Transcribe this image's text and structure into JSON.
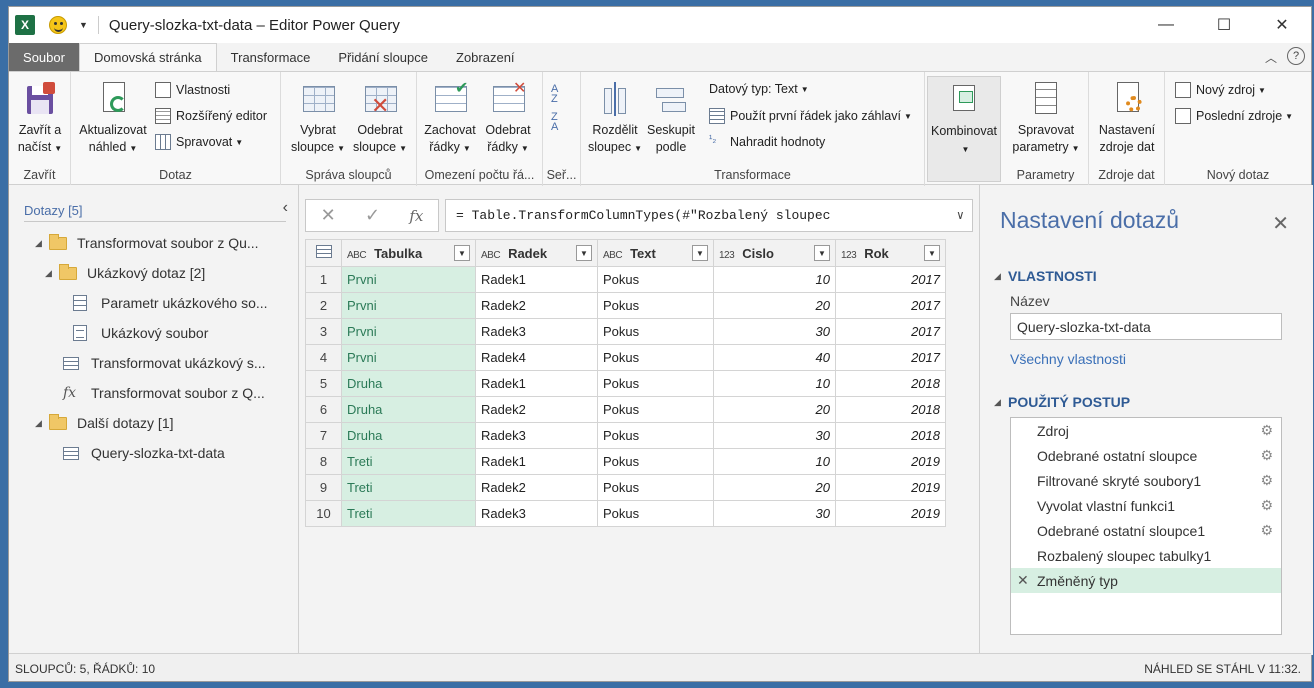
{
  "window": {
    "title": "Query-slozka-txt-data – Editor Power Query",
    "app_icon": "X",
    "minimize": "—",
    "maximize": "☐",
    "close": "✕"
  },
  "tabs": [
    "Soubor",
    "Domovská stránka",
    "Transformace",
    "Přidání sloupce",
    "Zobrazení"
  ],
  "ribbon": {
    "close_load": "Zavřít a načíst",
    "refresh_preview": "Aktualizovat náhled",
    "properties": "Vlastnosti",
    "advanced_editor": "Rozšířený editor",
    "manage": "Spravovat",
    "choose_columns": "Vybrat sloupce",
    "remove_columns": "Odebrat sloupce",
    "keep_rows": "Zachovat řádky",
    "remove_rows": "Odebrat řádky",
    "split_column": "Rozdělit sloupec",
    "group_by": "Seskupit podle",
    "data_type": "Datový typ: Text",
    "use_first_row": "Použít první řádek jako záhlaví",
    "replace_values": "Nahradit hodnoty",
    "combine": "Kombinovat",
    "manage_params": "Spravovat parametry",
    "data_source_settings": "Nastavení zdroje dat",
    "new_source": "Nový zdroj",
    "recent_sources": "Poslední zdroje",
    "groups": {
      "close": "Zavřít",
      "query": "Dotaz",
      "manage_columns": "Správa sloupců",
      "reduce_rows": "Omezení počtu řá...",
      "sort": "Seř...",
      "transform": "Transformace",
      "parameters": "Parametry",
      "data_sources": "Zdroje dat",
      "new_query": "Nový dotaz"
    }
  },
  "queries": {
    "header": "Dotazy [5]",
    "items": [
      "Transformovat soubor z Qu...",
      "Ukázkový dotaz [2]",
      "Parametr ukázkového so...",
      "Ukázkový soubor",
      "Transformovat ukázkový s...",
      "Transformovat soubor z Q...",
      "Další dotazy [1]",
      "Query-slozka-txt-data"
    ]
  },
  "formula": {
    "text": "= Table.TransformColumnTypes(#\"Rozbalený sloupec",
    "cancel": "✕",
    "commit": "✓",
    "fx": "fx"
  },
  "grid": {
    "columns": [
      {
        "type": "ABC",
        "name": "Tabulka"
      },
      {
        "type": "ABC",
        "name": "Radek"
      },
      {
        "type": "ABC",
        "name": "Text"
      },
      {
        "type": "123",
        "name": "Cislo"
      },
      {
        "type": "123",
        "name": "Rok"
      }
    ],
    "rows": [
      [
        "1",
        "Prvni",
        "Radek1",
        "Pokus",
        "10",
        "2017"
      ],
      [
        "2",
        "Prvni",
        "Radek2",
        "Pokus",
        "20",
        "2017"
      ],
      [
        "3",
        "Prvni",
        "Radek3",
        "Pokus",
        "30",
        "2017"
      ],
      [
        "4",
        "Prvni",
        "Radek4",
        "Pokus",
        "40",
        "2017"
      ],
      [
        "5",
        "Druha",
        "Radek1",
        "Pokus",
        "10",
        "2018"
      ],
      [
        "6",
        "Druha",
        "Radek2",
        "Pokus",
        "20",
        "2018"
      ],
      [
        "7",
        "Druha",
        "Radek3",
        "Pokus",
        "30",
        "2018"
      ],
      [
        "8",
        "Treti",
        "Radek1",
        "Pokus",
        "10",
        "2019"
      ],
      [
        "9",
        "Treti",
        "Radek2",
        "Pokus",
        "20",
        "2019"
      ],
      [
        "10",
        "Treti",
        "Radek3",
        "Pokus",
        "30",
        "2019"
      ]
    ]
  },
  "settings": {
    "title": "Nastavení dotazů",
    "properties_header": "VLASTNOSTI",
    "name_label": "Název",
    "name_value": "Query-slozka-txt-data",
    "all_properties": "Všechny vlastnosti",
    "steps_header": "POUŽITÝ POSTUP",
    "steps": [
      "Zdroj",
      "Odebrané ostatní sloupce",
      "Filtrované skryté soubory1",
      "Vyvolat vlastní funkci1",
      "Odebrané ostatní sloupce1",
      "Rozbalený sloupec tabulky1",
      "Změněný typ"
    ]
  },
  "status": {
    "left": "SLOUPCŮ: 5, ŘÁDKŮ: 10",
    "right": "NÁHLED SE STÁHL V 11:32."
  }
}
